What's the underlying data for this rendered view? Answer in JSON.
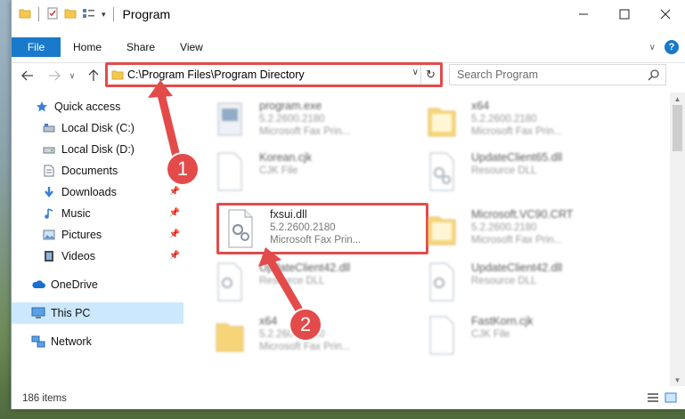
{
  "window": {
    "title": "Program"
  },
  "ribbon": {
    "file": "File",
    "home": "Home",
    "share": "Share",
    "view": "View",
    "help": "?"
  },
  "address": {
    "path": "C:\\Program Files\\Program Directory"
  },
  "search": {
    "placeholder": "Search Program"
  },
  "nav": {
    "quick_access": "Quick access",
    "local_c": "Local Disk (C:)",
    "local_d": "Local Disk (D:)",
    "documents": "Documents",
    "downloads": "Downloads",
    "music": "Music",
    "pictures": "Pictures",
    "videos": "Videos",
    "onedrive": "OneDrive",
    "this_pc": "This PC",
    "network": "Network"
  },
  "files": [
    {
      "name": "program.exe",
      "meta1": "5.2.2600.2180",
      "meta2": "Microsoft  Fax Prin...",
      "icon": "exe-icon"
    },
    {
      "name": "x64",
      "meta1": "5.2.2600.2180",
      "meta2": "Microsoft  Fax Prin...",
      "icon": "folder-icon"
    },
    {
      "name": "Korean.cjk",
      "meta1": "CJK File",
      "meta2": "",
      "icon": "file-icon"
    },
    {
      "name": "UpdateClient65.dll",
      "meta1": "Resource DLL",
      "meta2": "",
      "icon": "dll-icon"
    },
    {
      "name": "fxsui.dll",
      "meta1": "5.2.2600.2180",
      "meta2": "Microsoft  Fax Prin...",
      "icon": "dll-icon"
    },
    {
      "name": "Microsoft.VC90.CRT",
      "meta1": "5.2.2600.2180",
      "meta2": "Microsoft  Fax Prin...",
      "icon": "folder-icon"
    },
    {
      "name": "UpdateClient42.dll",
      "meta1": "Resource DLL",
      "meta2": "",
      "icon": "dll-icon"
    },
    {
      "name": "UpdateClient42.dll",
      "meta1": "Resource DLL",
      "meta2": "",
      "icon": "dll-icon"
    },
    {
      "name": "x64",
      "meta1": "5.2.2600.2180",
      "meta2": "Microsoft  Fax Prin...",
      "icon": "folder-icon"
    },
    {
      "name": "FastKorn.cjk",
      "meta1": "CJK File",
      "meta2": "",
      "icon": "file-icon"
    }
  ],
  "status": {
    "items": "186 items"
  },
  "callouts": {
    "one": "1",
    "two": "2"
  },
  "colors": {
    "accent": "#1979ca",
    "highlight": "#e34b4b",
    "selected": "#cce8ff"
  }
}
